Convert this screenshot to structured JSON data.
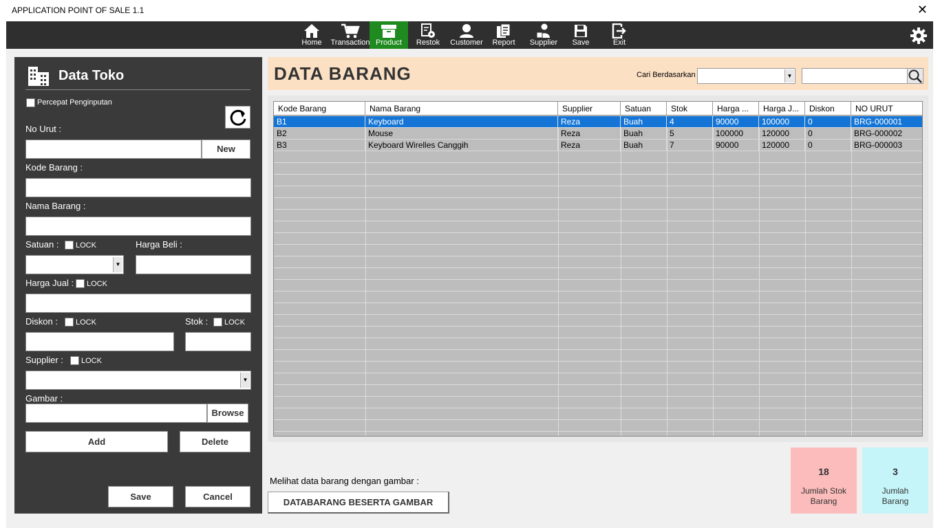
{
  "window": {
    "title": "APPLICATION POINT OF SALE 1.1",
    "close_glyph": "✕"
  },
  "nav": {
    "items": [
      {
        "label": "Home",
        "icon": "home-icon"
      },
      {
        "label": "Transaction",
        "icon": "cart-icon"
      },
      {
        "label": "Product",
        "icon": "box-icon"
      },
      {
        "label": "Restok",
        "icon": "restock-icon"
      },
      {
        "label": "Customer",
        "icon": "user-icon"
      },
      {
        "label": "Report",
        "icon": "report-icon"
      },
      {
        "label": "Supplier",
        "icon": "supplier-icon"
      },
      {
        "label": "Save",
        "icon": "floppy-icon"
      },
      {
        "label": "Exit",
        "icon": "exit-icon"
      }
    ],
    "active": "Product",
    "active_color": "#1f8a1f"
  },
  "form": {
    "title": "Data Toko",
    "percepat_label": "Percepat Penginputan",
    "no_urut_label": "No Urut :",
    "new_button": "New",
    "kode_label": "Kode Barang :",
    "nama_label": "Nama Barang :",
    "satuan_label": "Satuan :",
    "harga_beli_label": "Harga Beli :",
    "harga_jual_label": "Harga Jual :",
    "diskon_label": "Diskon :",
    "stok_label": "Stok :",
    "supplier_label": "Supplier :",
    "gambar_label": "Gambar :",
    "lock_label": "LOCK",
    "browse_button": "Browse",
    "add_button": "Add",
    "delete_button": "Delete",
    "save_button": "Save",
    "cancel_button": "Cancel"
  },
  "header": {
    "title": "DATA BARANG",
    "cari_label": "Cari Berdasarkan"
  },
  "table": {
    "columns": [
      "Kode Barang",
      "Nama Barang",
      "Supplier",
      "Satuan",
      "Stok",
      "Harga ...",
      "Harga J...",
      "Diskon",
      "NO URUT"
    ],
    "rows": [
      [
        "B1",
        "Keyboard",
        "Reza",
        "Buah",
        "4",
        "90000",
        "100000",
        "0",
        "BRG-000001"
      ],
      [
        "B2",
        "Mouse",
        "Reza",
        "Buah",
        "5",
        "100000",
        "120000",
        "0",
        "BRG-000002"
      ],
      [
        "B3",
        "Keyboard Wirelles Canggih",
        "Reza",
        "Buah",
        "7",
        "90000",
        "120000",
        "0",
        "BRG-000003"
      ]
    ],
    "selected_row": 0,
    "selection_color": "#1475d6"
  },
  "stats": [
    {
      "value": "18",
      "caption_line1": "Jumlah Stok",
      "caption_line2": "Barang",
      "color": "#fcbcbc"
    },
    {
      "value": "3",
      "caption_line1": "Jumlah",
      "caption_line2": "Barang",
      "color": "#c5f5f8"
    }
  ],
  "footer": {
    "hint": "Melihat data barang dengan gambar :",
    "gallery_button": "DATABARANG BESERTA GAMBAR"
  }
}
